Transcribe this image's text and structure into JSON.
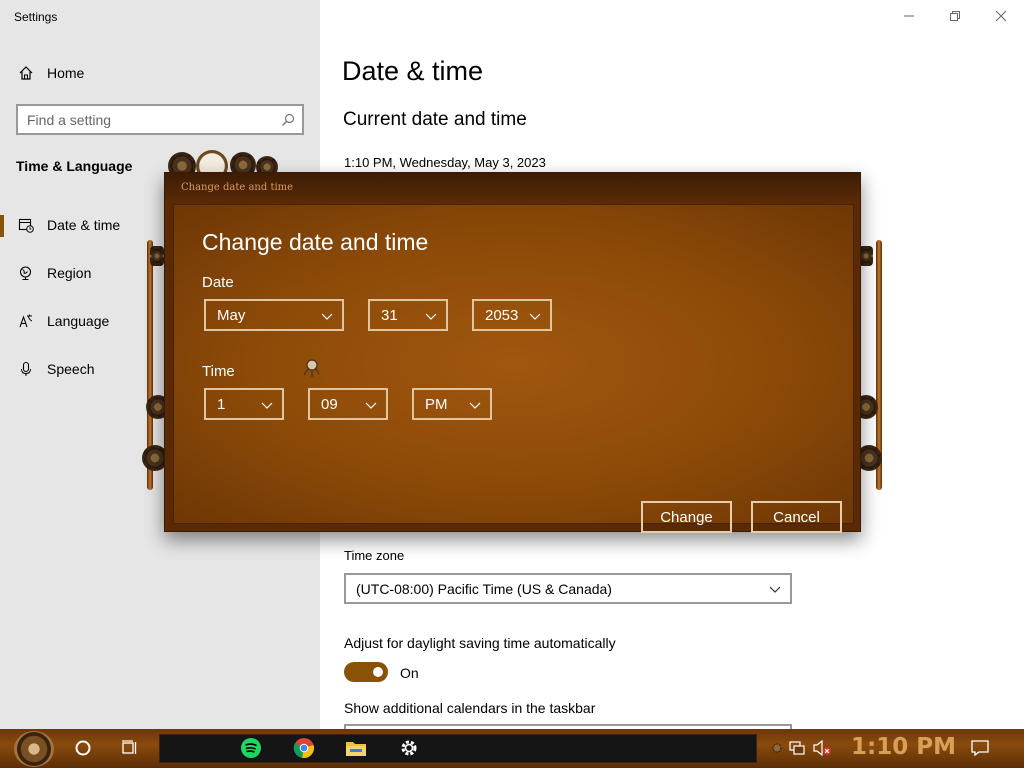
{
  "window": {
    "title": "Settings"
  },
  "sidebar": {
    "home_label": "Home",
    "search_placeholder": "Find a setting",
    "section_title": "Time & Language",
    "items": [
      {
        "label": "Date & time",
        "icon": "calendar-clock-icon",
        "active": true
      },
      {
        "label": "Region",
        "icon": "globe-icon",
        "active": false
      },
      {
        "label": "Language",
        "icon": "language-icon",
        "active": false
      },
      {
        "label": "Speech",
        "icon": "microphone-icon",
        "active": false
      }
    ]
  },
  "main": {
    "page_title": "Date & time",
    "current_heading": "Current date and time",
    "current_value": "1:10 PM, Wednesday, May 3, 2023",
    "timezone_label": "Time zone",
    "timezone_value": "(UTC-08:00) Pacific Time (US & Canada)",
    "dst_label": "Adjust for daylight saving time automatically",
    "dst_state": "On",
    "calendars_label": "Show additional calendars in the taskbar"
  },
  "dialog": {
    "caption": "Change date and time",
    "heading": "Change date and time",
    "date_label": "Date",
    "month": "May",
    "day": "31",
    "year": "2053",
    "time_label": "Time",
    "hour": "1",
    "minute": "09",
    "ampm": "PM",
    "change_label": "Change",
    "cancel_label": "Cancel"
  },
  "taskbar": {
    "clock": "1:10 PM",
    "pinned": [
      "spotify-icon",
      "chrome-icon",
      "file-explorer-icon",
      "settings-gear-icon"
    ]
  },
  "colors": {
    "accent": "#8a5207",
    "dialog_bg": "#8c4a08",
    "taskbar": "#6b3808",
    "clock_text": "#d6a057"
  }
}
